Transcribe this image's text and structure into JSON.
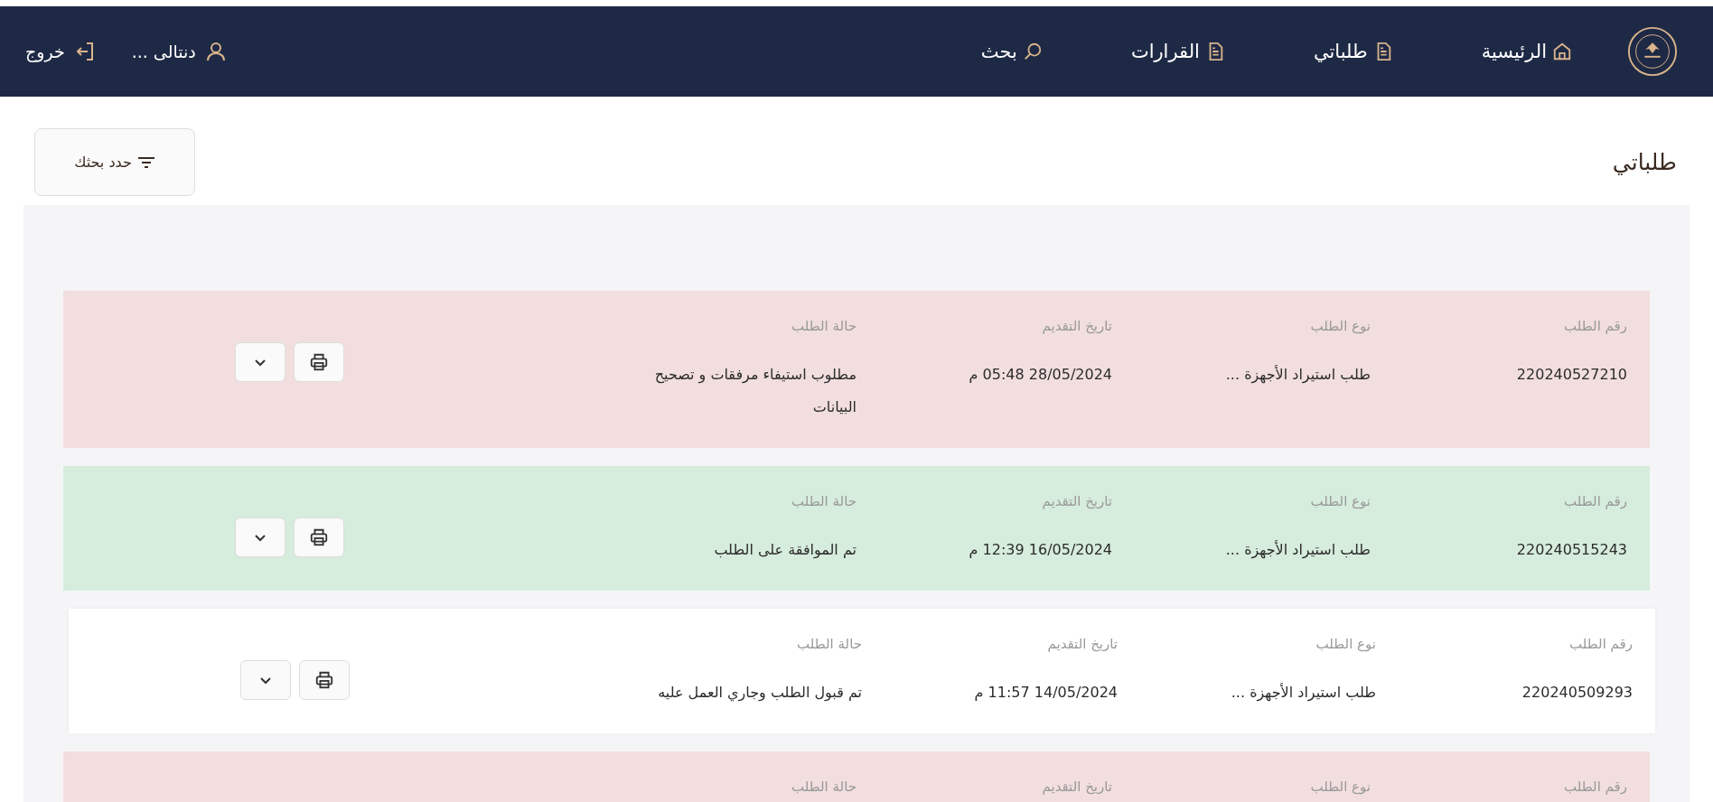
{
  "header": {
    "nav": [
      {
        "label": "الرئيسية",
        "kind": "home"
      },
      {
        "label": "طلباتي",
        "kind": "file"
      },
      {
        "label": "القرارات",
        "kind": "file"
      },
      {
        "label": "بحث",
        "kind": "search"
      }
    ],
    "user": {
      "name": "دنتالى ..."
    },
    "logout": {
      "label": "خروج"
    }
  },
  "page": {
    "title": "طلباتي",
    "filter_button": "حدد بحثك"
  },
  "requests": [
    {
      "color": "#f2dede",
      "fields": [
        {
          "label": "رقم الطلب",
          "value": "220240527210"
        },
        {
          "label": "نوع الطلب",
          "value": "طلب استيراد الأجهزة ..."
        },
        {
          "label": "تاريخ التقديم",
          "value": "28/05/2024 05:48 م"
        },
        {
          "label": "حالة الطلب",
          "value": "مطلوب استيفاء مرفقات و تصحيح البيانات"
        }
      ]
    },
    {
      "color": "#d6ecdc",
      "fields": [
        {
          "label": "رقم الطلب",
          "value": "220240515243"
        },
        {
          "label": "نوع الطلب",
          "value": "طلب استيراد الأجهزة ..."
        },
        {
          "label": "تاريخ التقديم",
          "value": "16/05/2024 12:39 م"
        },
        {
          "label": "حالة الطلب",
          "value": "تم الموافقة على الطلب"
        }
      ]
    },
    {
      "color": "#ffffff",
      "fields": [
        {
          "label": "رقم الطلب",
          "value": "220240509293"
        },
        {
          "label": "نوع الطلب",
          "value": "طلب استيراد الأجهزة ..."
        },
        {
          "label": "تاريخ التقديم",
          "value": "14/05/2024 11:57 م"
        },
        {
          "label": "حالة الطلب",
          "value": "تم قبول الطلب وجاري العمل عليه"
        }
      ]
    },
    {
      "color": "#f2dede",
      "fields": [
        {
          "label": "رقم الطلب"
        },
        {
          "label": "نوع الطلب"
        },
        {
          "label": "تاريخ التقديم"
        },
        {
          "label": "حالة الطلب"
        }
      ]
    }
  ]
}
